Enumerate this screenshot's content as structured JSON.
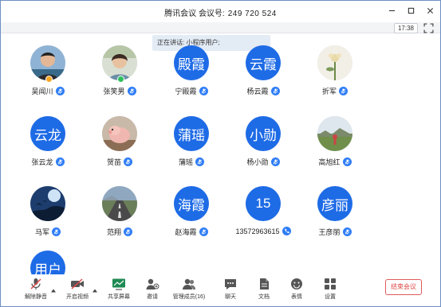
{
  "title": {
    "app": "腾讯会议",
    "meeting_label": "会议号:",
    "meeting_id": "249 720 524"
  },
  "timer": "17:38",
  "speaking": "正在讲话: 小程序用户;",
  "participants": [
    {
      "name": "吴闻川",
      "avatar_text": "",
      "avatar_type": "photo-man",
      "badge_color": "#f5a623"
    },
    {
      "name": "张笑男",
      "avatar_text": "",
      "avatar_type": "photo-woman",
      "badge_color": "#2fbf5a"
    },
    {
      "name": "宁殿霞",
      "avatar_text": "殿霞",
      "avatar_type": "text"
    },
    {
      "name": "杨云霞",
      "avatar_text": "云霞",
      "avatar_type": "text"
    },
    {
      "name": "折军",
      "avatar_text": "",
      "avatar_type": "photo-flower"
    },
    {
      "name": "张云龙",
      "avatar_text": "云龙",
      "avatar_type": "text"
    },
    {
      "name": "贺苗",
      "avatar_text": "",
      "avatar_type": "photo-pig"
    },
    {
      "name": "蒲瑶",
      "avatar_text": "蒲瑶",
      "avatar_type": "text"
    },
    {
      "name": "杨小勋",
      "avatar_text": "小勋",
      "avatar_type": "text"
    },
    {
      "name": "高旭红",
      "avatar_text": "",
      "avatar_type": "photo-landscape"
    },
    {
      "name": "马军",
      "avatar_text": "",
      "avatar_type": "photo-night"
    },
    {
      "name": "范翔",
      "avatar_text": "",
      "avatar_type": "photo-road"
    },
    {
      "name": "赵海霞",
      "avatar_text": "海霞",
      "avatar_type": "text"
    },
    {
      "name": "13572963615",
      "avatar_text": "15",
      "avatar_type": "text",
      "phone": true
    },
    {
      "name": "王彦丽",
      "avatar_text": "彦丽",
      "avatar_type": "text"
    },
    {
      "name": "",
      "avatar_text": "用户",
      "avatar_type": "text"
    }
  ],
  "toolbar": {
    "unmute": "解除静音",
    "video": "开启视频",
    "share": "共享屏幕",
    "invite": "邀请",
    "manage": "管理成员(16)",
    "chat": "聊天",
    "docs": "文档",
    "emoji": "表情",
    "settings": "设置",
    "end": "结束会议"
  },
  "colors": {
    "accent": "#1e6be6",
    "mic": "#2f7df6",
    "danger": "#e04848"
  }
}
